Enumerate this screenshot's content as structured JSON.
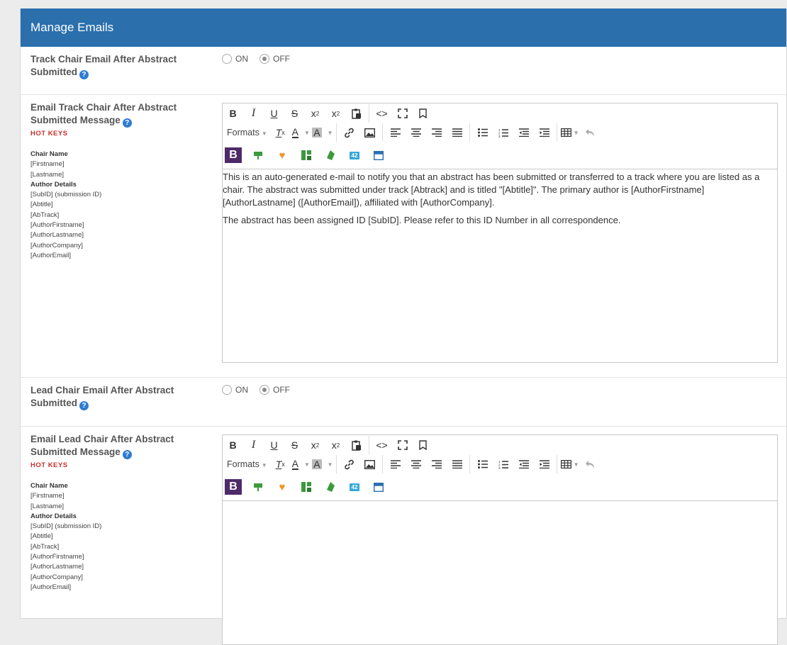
{
  "header": {
    "title": "Manage Emails"
  },
  "toggle_options": {
    "on": "ON",
    "off": "OFF"
  },
  "section1": {
    "label": "Track Chair Email After Abstract Submitted",
    "state": "OFF"
  },
  "section2": {
    "label": "Email Track Chair After Abstract Submitted Message",
    "hotkeys": "HOT KEYS",
    "message": [
      "This is an auto-generated e-mail to notify you that an abstract has been submitted or transferred to a track where you are listed as a chair. The abstract was submitted under track [Abtrack] and is titled \"[Abtitle]\". The primary author is [AuthorFirstname] [AuthorLastname] ([AuthorEmail]), affiliated with [AuthorCompany].",
      "The abstract has been assigned ID [SubID]. Please refer to this ID Number in all correspondence."
    ]
  },
  "section3": {
    "label": "Lead Chair Email After Abstract Submitted",
    "state": "OFF"
  },
  "section4": {
    "label": "Email Lead Chair After Abstract Submitted Message",
    "hotkeys": "HOT KEYS"
  },
  "hotkey_list": {
    "chair_header": "Chair Name",
    "chair_keys": [
      "[Firstname]",
      "[Lastname]"
    ],
    "author_header": "Author Details",
    "author_keys": [
      "[SubID] (submission ID)",
      "[Abtitle]",
      "[AbTrack]",
      "[AuthorFirstname]",
      "[AuthorLastname]",
      "[AuthorCompany]",
      "[AuthorEmail]"
    ]
  },
  "editor": {
    "formats_label": "Formats",
    "toolbar_icons": {
      "row1": [
        "bold-icon",
        "italic-icon",
        "underline-icon",
        "strikethrough-icon",
        "superscript-icon",
        "subscript-icon",
        "paste-icon",
        "source-code-icon",
        "fullscreen-icon",
        "bookmark-icon"
      ],
      "row2": [
        "formats-dropdown",
        "clear-format-icon",
        "text-color-icon",
        "background-color-icon",
        "link-icon",
        "image-icon",
        "align-left-icon",
        "align-center-icon",
        "align-right-icon",
        "justify-icon",
        "bullet-list-icon",
        "numbered-list-icon",
        "outdent-icon",
        "indent-icon",
        "table-icon",
        "undo-icon"
      ],
      "row3": [
        "bootstrap-icon",
        "paint-icon",
        "heart-icon",
        "layout-icon",
        "tag-icon",
        "number-icon",
        "panel-icon"
      ]
    },
    "plugin_colors": {
      "bootstrap": "#4e2a69",
      "paint": "#3c9a3c",
      "heart": "#f0962a",
      "layout": "#3c9a3c",
      "tag": "#3c9a3c",
      "number": "#38a9d4",
      "panel": "#2b6fad"
    },
    "badge_text": {
      "bootstrap": "B",
      "number": "42"
    }
  },
  "colors": {
    "header_bg": "#2b6fad",
    "hotkeys": "#c9302c",
    "help_icon": "#2f7bd1"
  }
}
